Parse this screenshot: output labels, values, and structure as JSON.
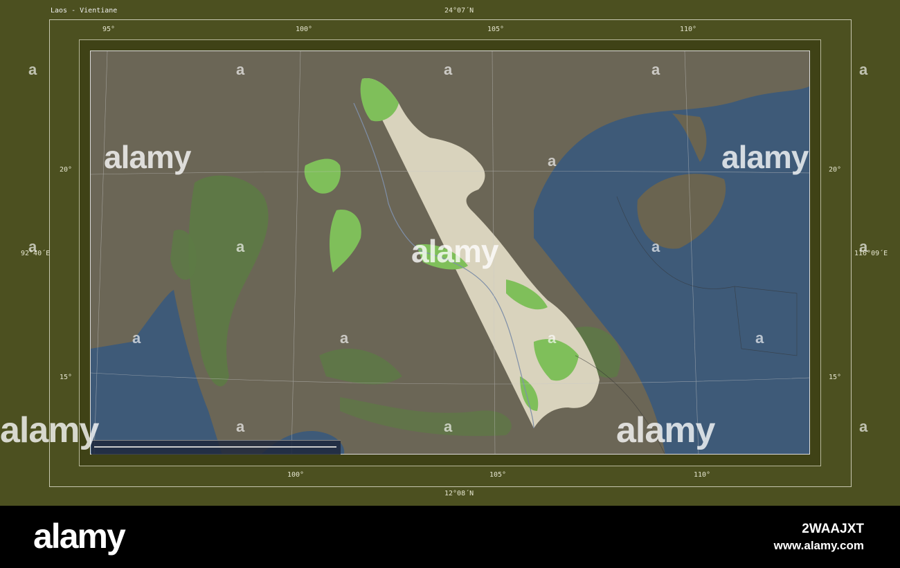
{
  "map": {
    "title": "Laos - Vientiane",
    "top_lat": "24°07´N",
    "bottom_lat": "12°08´N",
    "left_lon": "92°40´E",
    "right_lon": "116°09´E",
    "top_lon_ticks": [
      "95°",
      "100°",
      "105°",
      "110°"
    ],
    "bottom_lon_ticks": [
      "100°",
      "105°",
      "110°"
    ],
    "left_lat_ticks": [
      "20°",
      "15°"
    ],
    "right_lat_ticks": [
      "20°",
      "15°"
    ],
    "colors": {
      "frame": "#4c5020",
      "band": "#3f4216",
      "sea": "#3e5a78",
      "land": "#6b6656",
      "highlight_country": "#d9d3bd",
      "forest": "#7fbf5a"
    }
  },
  "watermark": {
    "text": "alamy",
    "letter": "a"
  },
  "footer": {
    "brand": "alamy",
    "image_id": "2WAAJXT",
    "url": "www.alamy.com"
  }
}
